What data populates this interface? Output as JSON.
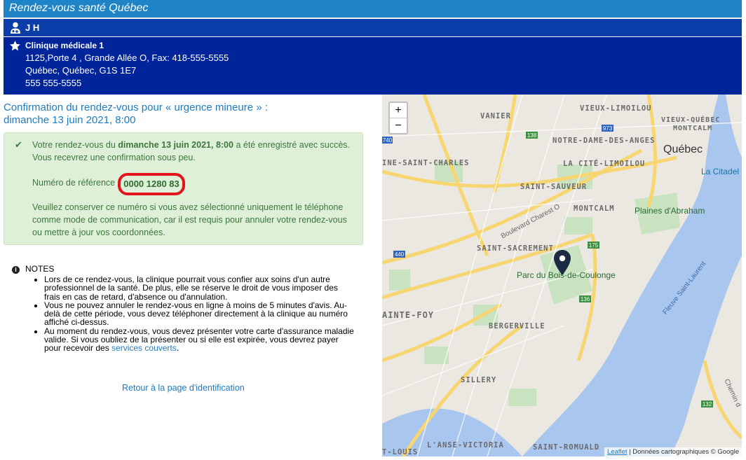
{
  "app": {
    "title": "Rendez-vous santé Québec"
  },
  "user": {
    "name": "J H",
    "icon": "user-doctor-icon"
  },
  "clinic": {
    "icon": "star-icon",
    "name": "Clinique médicale 1",
    "address_line1": "1125,Porte 4 , Grande Allée O, Fax: 418-555-5555",
    "address_line2": "Québec, Québec, G1S 1E7",
    "phone": "555 555-5555"
  },
  "confirmation": {
    "title_line1": "Confirmation du rendez-vous pour « urgence mineure » :",
    "title_line2": "dimanche 13 juin 2021, 8:00"
  },
  "alert": {
    "text_before": "Votre rendez-vous du ",
    "date_bold": "dimanche 13 juin 2021, 8:00",
    "text_after": " a été enregistré avec succès. Vous recevrez une confirmation sous peu.",
    "reference_label": "Numéro de référence",
    "reference_number": "0000 1280 83",
    "keep_notice": "Veuillez conserver ce numéro si vous avez sélectionné uniquement le téléphone comme mode de communication, car il est requis pour annuler votre rendez-vous ou mettre à jour vos coordonnées.",
    "highlight_color": "#e3141b"
  },
  "notes": {
    "heading": "NOTES",
    "items": [
      "Lors de ce rendez-vous, la clinique pourrait vous confier aux soins d'un autre professionnel de la santé. De plus, elle se réserve le droit de vous imposer des frais en cas de retard, d'absence ou d'annulation.",
      "Vous ne pouvez annuler le rendez-vous en ligne à moins de 5 minutes d'avis. Au-delà de cette période, vous devez téléphoner directement à la clinique au numéro affiché ci-dessus.",
      "Au moment du rendez-vous, vous devez présenter votre carte d'assurance maladie valide. Si vous oubliez de la présenter ou si elle est expirée, vous devrez payer pour recevoir des "
    ],
    "services_link": "services couverts",
    "services_suffix": "."
  },
  "return_link": "Retour à la page d'identification",
  "map": {
    "zoom_in": "+",
    "zoom_out": "−",
    "attribution_link": "Leaflet",
    "attribution_text": " | Données cartographiques © Google",
    "labels": {
      "vanier": "VANIER",
      "vieux_limoilou": "VIEUX-LIMOILOU",
      "vieux_quebec": "VIEUX-QUÉBEC",
      "montcalm_top": "MONTCALM",
      "notre_dame": "NOTRE-DAME-DES-ANGES",
      "quebec": "Québec",
      "saint_charles": "INE-SAINT-CHARLES",
      "cite_limoilou": "LA CITÉ-LIMOILOU",
      "citadelle": "La Citadel",
      "saint_sauveur": "SAINT-SAUVEUR",
      "montcalm": "MONTCALM",
      "plaines": "Plaines d'Abraham",
      "saint_sacrement": "SAINT-SACREMENT",
      "parc": "Parc du Bois-de-Coulonge",
      "sainte_foy": "AINTE-FOY",
      "bergerville": "BERGERVILLE",
      "sillery": "SILLERY",
      "anse_victoria": "L'ANSE-VICTORIA",
      "saint_romuald": "SAINT-ROMUALD",
      "t_louis": "T-LOUIS",
      "fleuve": "Fleuve Saint-Laurent",
      "blvd_charest": "Boulevard Charest O",
      "chemin": "Chemin d"
    },
    "route_shields": [
      "138",
      "973",
      "440",
      "175",
      "175",
      "136",
      "440",
      "132"
    ],
    "water_color": "#a9c6ee",
    "park_color": "#c9e3c0",
    "road_color": "#f7d672"
  }
}
